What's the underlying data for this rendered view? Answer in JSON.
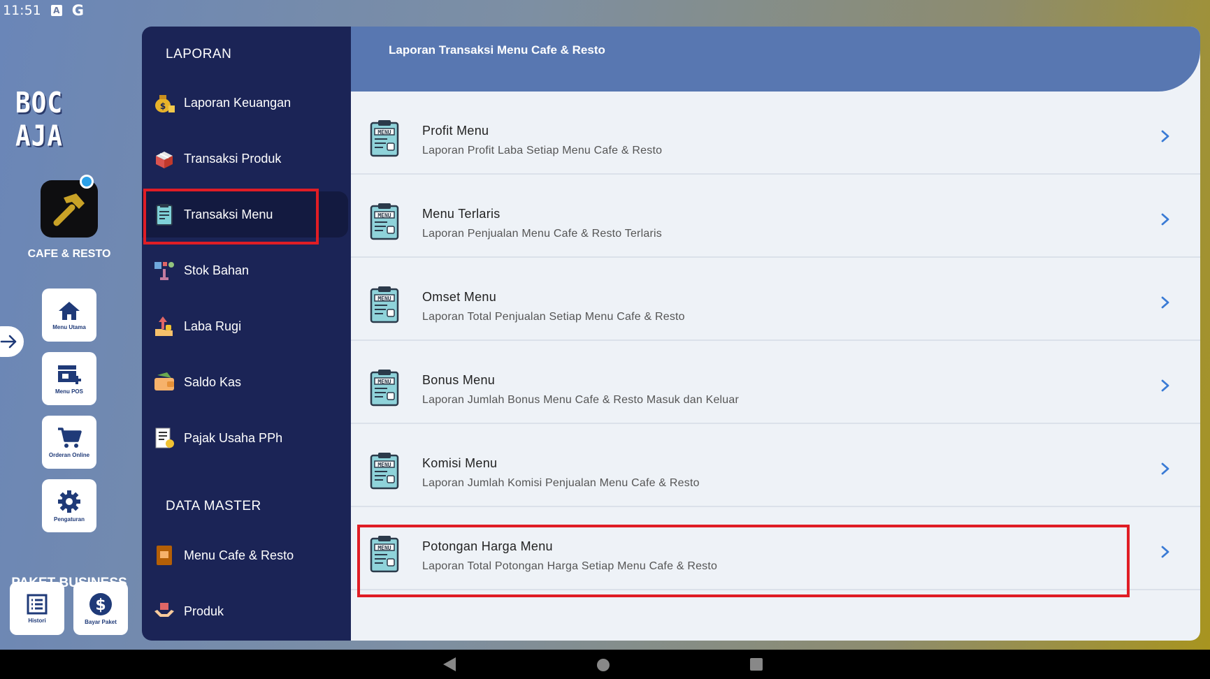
{
  "status_bar": {
    "time": "11:51",
    "icon_a": "A",
    "icon_g": "G"
  },
  "rail": {
    "logo_text": "BOC AJA",
    "app_name": "CAFE & RESTO",
    "buttons": [
      {
        "label": "Menu Utama",
        "icon": "home-icon"
      },
      {
        "label": "Menu POS",
        "icon": "store-add-icon"
      },
      {
        "label": "Orderan Online",
        "icon": "cart-icon"
      },
      {
        "label": "Pengaturan",
        "icon": "gear-icon"
      }
    ],
    "paket_title": "PAKET BUSINESS",
    "paket_buttons": [
      {
        "label": "Histori",
        "icon": "list-icon"
      },
      {
        "label": "Bayar Paket",
        "icon": "dollar-icon"
      }
    ]
  },
  "sidebar": {
    "section_laporan": "LAPORAN",
    "laporan_items": [
      {
        "label": "Laporan Keuangan",
        "icon": "money-bag-icon"
      },
      {
        "label": "Transaksi Produk",
        "icon": "box-icon"
      },
      {
        "label": "Transaksi Menu",
        "icon": "menu-board-icon"
      },
      {
        "label": "Stok Bahan",
        "icon": "ingredients-icon"
      },
      {
        "label": "Laba Rugi",
        "icon": "profit-hand-icon"
      },
      {
        "label": "Saldo Kas",
        "icon": "wallet-icon"
      },
      {
        "label": "Pajak Usaha PPh",
        "icon": "tax-document-icon"
      }
    ],
    "section_master": "DATA MASTER",
    "master_items": [
      {
        "label": "Menu Cafe & Resto",
        "icon": "menu-book-icon"
      },
      {
        "label": "Produk",
        "icon": "hands-box-icon"
      }
    ]
  },
  "main": {
    "title": "Laporan Transaksi Menu Cafe & Resto",
    "rows": [
      {
        "title": "Profit Menu",
        "subtitle": "Laporan Profit Laba Setiap Menu Cafe & Resto"
      },
      {
        "title": "Menu Terlaris",
        "subtitle": "Laporan Penjualan Menu Cafe & Resto Terlaris"
      },
      {
        "title": "Omset Menu",
        "subtitle": "Laporan Total Penjualan Setiap Menu Cafe & Resto"
      },
      {
        "title": "Bonus Menu",
        "subtitle": "Laporan Jumlah Bonus Menu Cafe & Resto Masuk dan Keluar"
      },
      {
        "title": "Komisi Menu",
        "subtitle": "Laporan Jumlah Komisi Penjualan Menu Cafe & Resto"
      },
      {
        "title": "Potongan Harga Menu",
        "subtitle": "Laporan Total Potongan Harga Setiap Menu Cafe & Resto"
      }
    ]
  },
  "colors": {
    "sidebar_bg": "#1b2456",
    "header_bg": "#5877b1",
    "highlight": "#e01d25",
    "chevron": "#3a7bd5"
  }
}
